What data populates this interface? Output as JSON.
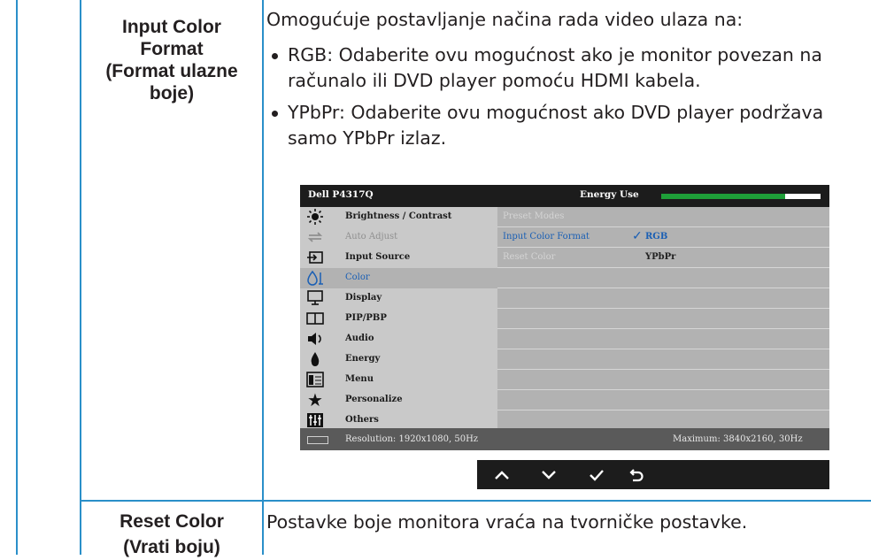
{
  "rows": [
    {
      "setting": "Input Color Format (Format ulazne boje)",
      "setting_lines": [
        "Input Color",
        "Format",
        "(Format ulazne",
        "boje)"
      ],
      "description": "Omogućuje postavljanje načina rada video ulaza na:",
      "bullets": [
        "RGB: Odaberite ovu mogućnost ako je monitor povezan na računalo ili DVD player pomoću HDMI kabela.",
        "YPbPr: Odaberite ovu mogućnost ako DVD player podržava samo YPbPr izlaz."
      ]
    },
    {
      "setting_lines": [
        "Reset Color",
        "(Vrati boju)"
      ],
      "description": "Postavke boje monitora vraća na tvorničke postavke."
    }
  ],
  "osd": {
    "model": "Dell P4317Q",
    "energy_label": "Energy Use",
    "energy_level": 0.78,
    "menu": [
      {
        "label": "Brightness / Contrast",
        "icon": "brightness-icon",
        "state": "normal"
      },
      {
        "label": "Auto Adjust",
        "icon": "auto-adjust-icon",
        "state": "dim"
      },
      {
        "label": "Input Source",
        "icon": "input-source-icon",
        "state": "normal"
      },
      {
        "label": "Color",
        "icon": "color-icon",
        "state": "selected"
      },
      {
        "label": "Display",
        "icon": "display-icon",
        "state": "normal"
      },
      {
        "label": "PIP/PBP",
        "icon": "pip-pbp-icon",
        "state": "normal"
      },
      {
        "label": "Audio",
        "icon": "audio-icon",
        "state": "normal"
      },
      {
        "label": "Energy",
        "icon": "energy-icon",
        "state": "normal"
      },
      {
        "label": "Menu",
        "icon": "menu-icon",
        "state": "normal"
      },
      {
        "label": "Personalize",
        "icon": "personalize-icon",
        "state": "normal"
      },
      {
        "label": "Others",
        "icon": "others-icon",
        "state": "normal"
      }
    ],
    "submenu": [
      {
        "label": "Preset Modes",
        "active": false
      },
      {
        "label": "Input Color Format",
        "active": true,
        "options": [
          "RGB"
        ],
        "selected": "RGB"
      },
      {
        "label": "Reset Color",
        "active": false,
        "options": [
          "YPbPr"
        ]
      }
    ],
    "resolution": "Resolution: 1920x1080, 50Hz",
    "maximum": "Maximum: 3840x2160, 30Hz",
    "nav_buttons": [
      "up-icon",
      "down-icon",
      "check-icon",
      "back-icon"
    ]
  },
  "colors": {
    "border": "#2a8fc9",
    "osd_dark": "#1c1c1c",
    "osd_accent": "#1a5fb4",
    "energy": "#1e9e38"
  }
}
